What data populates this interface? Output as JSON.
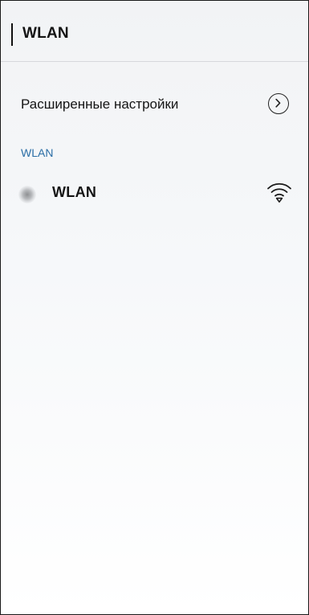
{
  "header": {
    "title": "WLAN"
  },
  "advanced": {
    "label": "Расширенные настройки",
    "icon": "chevron-right-circle-icon"
  },
  "section": {
    "label": "WLAN",
    "color": "#2a6ea6"
  },
  "network": {
    "status_icon": "loading-spinner-icon",
    "label": "WLAN",
    "signal_icon": "wifi-signal-icon"
  }
}
